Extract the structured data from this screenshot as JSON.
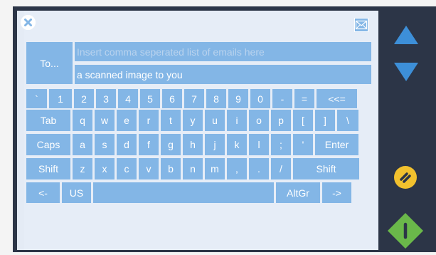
{
  "compose": {
    "to_label": "To...",
    "to_placeholder": "Insert comma seperated list of emails here",
    "subject_value": "a scanned image to you"
  },
  "keyboard": {
    "row1": [
      "`",
      "1",
      "2",
      "3",
      "4",
      "5",
      "6",
      "7",
      "8",
      "9",
      "0",
      "-",
      "=",
      "<<="
    ],
    "row2": [
      "Tab",
      "q",
      "w",
      "e",
      "r",
      "t",
      "y",
      "u",
      "i",
      "o",
      "p",
      "[",
      "]",
      "\\"
    ],
    "row3": [
      "Caps",
      "a",
      "s",
      "d",
      "f",
      "g",
      "h",
      "j",
      "k",
      "l",
      ";",
      "'",
      "Enter"
    ],
    "row4": [
      "Shift",
      "z",
      "x",
      "c",
      "v",
      "b",
      "n",
      "m",
      ",",
      ".",
      "/",
      "Shift"
    ],
    "row5": [
      "<-",
      "US",
      "",
      "AltGr",
      "->"
    ]
  },
  "icons": {
    "close": "close-circle-icon",
    "mail": "envelope-icon",
    "up": "arrow-up-icon",
    "down": "arrow-down-icon",
    "cancel": "cancel-stop-icon",
    "start": "start-go-icon"
  },
  "colors": {
    "key": "#83b6e6",
    "frame": "#2c3547",
    "panel": "#e4ebf5",
    "arrow": "#3d8fd8",
    "cancel": "#f2c12e",
    "start": "#6ab84a"
  }
}
